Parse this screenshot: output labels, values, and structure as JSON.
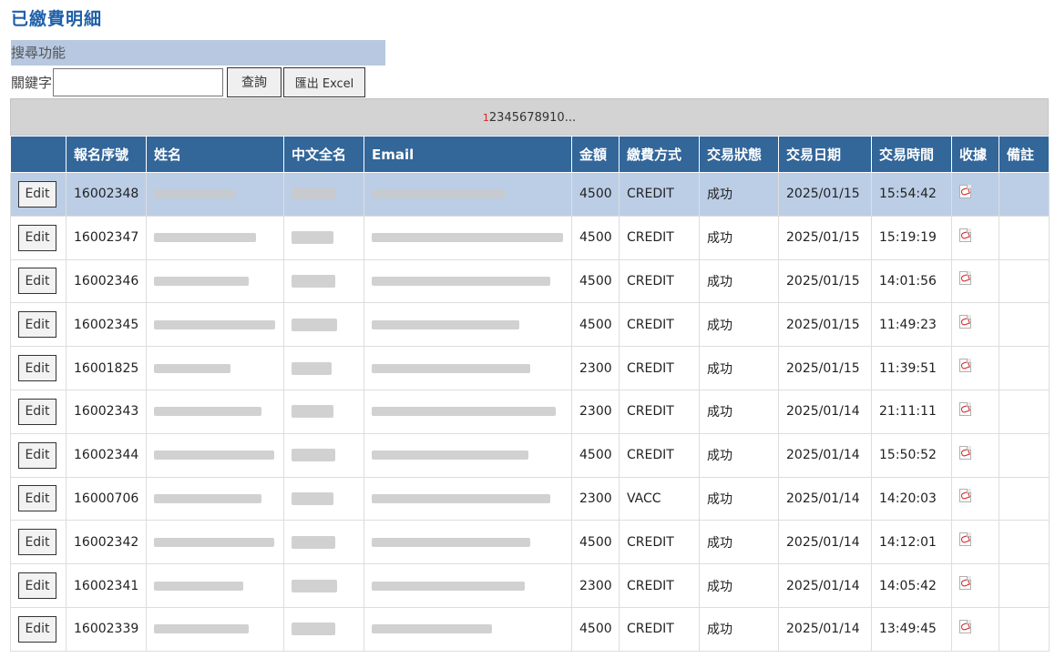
{
  "title": "已繳費明細",
  "search": {
    "header": "搜尋功能",
    "keyword_label": "關鍵字",
    "keyword_value": "",
    "query_button": "查詢",
    "export_button": "匯出 Excel"
  },
  "pager": {
    "current": "1",
    "pages": [
      "2",
      "3",
      "4",
      "5",
      "6",
      "7",
      "8",
      "9",
      "10",
      "..."
    ]
  },
  "columns": [
    "",
    "報名序號",
    "姓名",
    "中文全名",
    "Email",
    "金額",
    "繳費方式",
    "交易狀態",
    "交易日期",
    "交易時間",
    "收據",
    "備註"
  ],
  "edit_label": "Edit",
  "rows": [
    {
      "serial": "16002348",
      "amount": "4500",
      "method": "CREDIT",
      "status": "成功",
      "date": "2025/01/15",
      "time": "15:54:42",
      "note": ""
    },
    {
      "serial": "16002347",
      "amount": "4500",
      "method": "CREDIT",
      "status": "成功",
      "date": "2025/01/15",
      "time": "15:19:19",
      "note": ""
    },
    {
      "serial": "16002346",
      "amount": "4500",
      "method": "CREDIT",
      "status": "成功",
      "date": "2025/01/15",
      "time": "14:01:56",
      "note": ""
    },
    {
      "serial": "16002345",
      "amount": "4500",
      "method": "CREDIT",
      "status": "成功",
      "date": "2025/01/15",
      "time": "11:49:23",
      "note": ""
    },
    {
      "serial": "16001825",
      "amount": "2300",
      "method": "CREDIT",
      "status": "成功",
      "date": "2025/01/15",
      "time": "11:39:51",
      "note": ""
    },
    {
      "serial": "16002343",
      "amount": "2300",
      "method": "CREDIT",
      "status": "成功",
      "date": "2025/01/14",
      "time": "21:11:11",
      "note": ""
    },
    {
      "serial": "16002344",
      "amount": "4500",
      "method": "CREDIT",
      "status": "成功",
      "date": "2025/01/14",
      "time": "15:50:52",
      "note": ""
    },
    {
      "serial": "16000706",
      "amount": "2300",
      "method": "VACC",
      "status": "成功",
      "date": "2025/01/14",
      "time": "14:20:03",
      "note": ""
    },
    {
      "serial": "16002342",
      "amount": "4500",
      "method": "CREDIT",
      "status": "成功",
      "date": "2025/01/14",
      "time": "14:12:01",
      "note": ""
    },
    {
      "serial": "16002341",
      "amount": "2300",
      "method": "CREDIT",
      "status": "成功",
      "date": "2025/01/14",
      "time": "14:05:42",
      "note": ""
    },
    {
      "serial": "16002339",
      "amount": "4500",
      "method": "CREDIT",
      "status": "成功",
      "date": "2025/01/14",
      "time": "13:49:45",
      "note": ""
    }
  ],
  "icons": {
    "receipt": "pdf-icon"
  },
  "colors": {
    "header_bg": "#336699",
    "selected_row_bg": "#bccee6",
    "title": "#1f5fa8",
    "current_page": "#e02020"
  }
}
